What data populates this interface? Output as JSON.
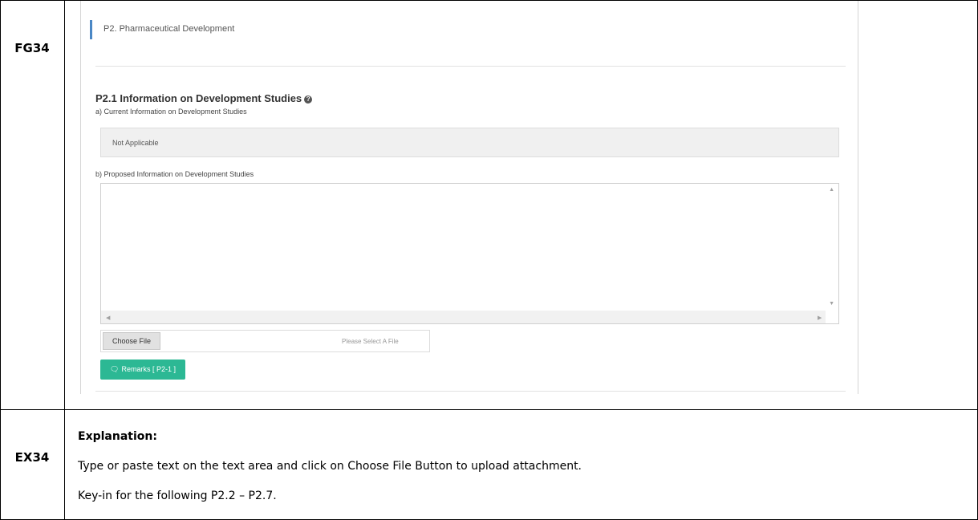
{
  "rows": {
    "figure_label": "FG34",
    "explanation_label": "EX34"
  },
  "form": {
    "section_title": "P2. Pharmaceutical Development",
    "subsection_title": "P2.1 Information on Development Studies",
    "help_icon": "question-circle-icon",
    "current_label": "a) Current Information on Development Studies",
    "current_value": "Not Applicable",
    "proposed_label": "b) Proposed Information on Development Studies",
    "proposed_value": "",
    "choose_file_label": "Choose File",
    "file_placeholder": "Please Select A File",
    "remarks_label": "Remarks [ P2-1 ]",
    "remarks_icon": "comments-icon",
    "accent_color": "#2cb894",
    "section_bar_color": "#4a87c5"
  },
  "explanation": {
    "title": "Explanation:",
    "line1": "Type or paste text on the text area and click on Choose File Button to upload attachment.",
    "line2": "Key-in for the following P2.2 – P2.7."
  }
}
